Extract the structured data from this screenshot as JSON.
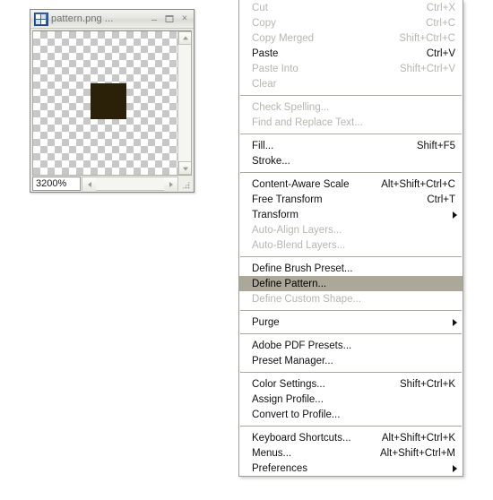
{
  "window": {
    "title": "pattern.png ...",
    "icon": "photoshop-document-icon",
    "buttons": {
      "minimize": "–",
      "maximize": "",
      "close": "×"
    },
    "zoom_level": "3200%",
    "canvas": {
      "transparency_checker": true,
      "checker_light": "#ffffff",
      "checker_dark": "#c8c8c8",
      "pattern_swatch_color": "#2b2109"
    }
  },
  "context_menu": {
    "groups": [
      {
        "items": [
          {
            "label": "Cut",
            "accel": "Ctrl+X",
            "disabled": true,
            "submenu": false,
            "highlight": false
          },
          {
            "label": "Copy",
            "accel": "Ctrl+C",
            "disabled": true,
            "submenu": false,
            "highlight": false
          },
          {
            "label": "Copy Merged",
            "accel": "Shift+Ctrl+C",
            "disabled": true,
            "submenu": false,
            "highlight": false
          },
          {
            "label": "Paste",
            "accel": "Ctrl+V",
            "disabled": false,
            "submenu": false,
            "highlight": false
          },
          {
            "label": "Paste Into",
            "accel": "Shift+Ctrl+V",
            "disabled": true,
            "submenu": false,
            "highlight": false
          },
          {
            "label": "Clear",
            "accel": "",
            "disabled": true,
            "submenu": false,
            "highlight": false
          }
        ]
      },
      {
        "items": [
          {
            "label": "Check Spelling...",
            "accel": "",
            "disabled": true,
            "submenu": false,
            "highlight": false
          },
          {
            "label": "Find and Replace Text...",
            "accel": "",
            "disabled": true,
            "submenu": false,
            "highlight": false
          }
        ]
      },
      {
        "items": [
          {
            "label": "Fill...",
            "accel": "Shift+F5",
            "disabled": false,
            "submenu": false,
            "highlight": false
          },
          {
            "label": "Stroke...",
            "accel": "",
            "disabled": false,
            "submenu": false,
            "highlight": false
          }
        ]
      },
      {
        "items": [
          {
            "label": "Content-Aware Scale",
            "accel": "Alt+Shift+Ctrl+C",
            "disabled": false,
            "submenu": false,
            "highlight": false
          },
          {
            "label": "Free Transform",
            "accel": "Ctrl+T",
            "disabled": false,
            "submenu": false,
            "highlight": false
          },
          {
            "label": "Transform",
            "accel": "",
            "disabled": false,
            "submenu": true,
            "highlight": false
          },
          {
            "label": "Auto-Align Layers...",
            "accel": "",
            "disabled": true,
            "submenu": false,
            "highlight": false
          },
          {
            "label": "Auto-Blend Layers...",
            "accel": "",
            "disabled": true,
            "submenu": false,
            "highlight": false
          }
        ]
      },
      {
        "items": [
          {
            "label": "Define Brush Preset...",
            "accel": "",
            "disabled": false,
            "submenu": false,
            "highlight": false
          },
          {
            "label": "Define Pattern...",
            "accel": "",
            "disabled": false,
            "submenu": false,
            "highlight": true
          },
          {
            "label": "Define Custom Shape...",
            "accel": "",
            "disabled": true,
            "submenu": false,
            "highlight": false
          }
        ]
      },
      {
        "items": [
          {
            "label": "Purge",
            "accel": "",
            "disabled": false,
            "submenu": true,
            "highlight": false
          }
        ]
      },
      {
        "items": [
          {
            "label": "Adobe PDF Presets...",
            "accel": "",
            "disabled": false,
            "submenu": false,
            "highlight": false
          },
          {
            "label": "Preset Manager...",
            "accel": "",
            "disabled": false,
            "submenu": false,
            "highlight": false
          }
        ]
      },
      {
        "items": [
          {
            "label": "Color Settings...",
            "accel": "Shift+Ctrl+K",
            "disabled": false,
            "submenu": false,
            "highlight": false
          },
          {
            "label": "Assign Profile...",
            "accel": "",
            "disabled": false,
            "submenu": false,
            "highlight": false
          },
          {
            "label": "Convert to Profile...",
            "accel": "",
            "disabled": false,
            "submenu": false,
            "highlight": false
          }
        ]
      },
      {
        "items": [
          {
            "label": "Keyboard Shortcuts...",
            "accel": "Alt+Shift+Ctrl+K",
            "disabled": false,
            "submenu": false,
            "highlight": false
          },
          {
            "label": "Menus...",
            "accel": "Alt+Shift+Ctrl+M",
            "disabled": false,
            "submenu": false,
            "highlight": false
          },
          {
            "label": "Preferences",
            "accel": "",
            "disabled": false,
            "submenu": true,
            "highlight": false
          }
        ]
      }
    ],
    "highlight_color": "#aca899"
  }
}
